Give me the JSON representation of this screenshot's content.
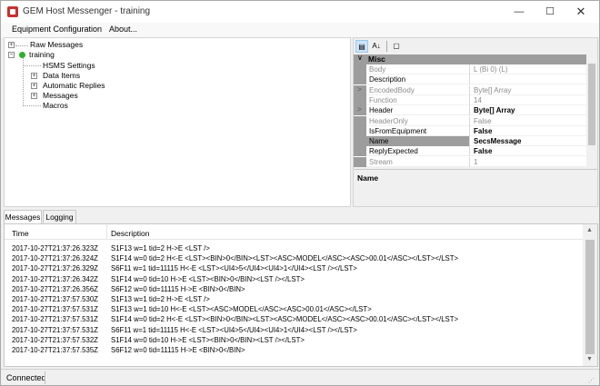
{
  "window": {
    "title": "GEM Host Messenger - training",
    "minimize_glyph": "—",
    "maximize_glyph": "☐",
    "close_glyph": "✕"
  },
  "menu": {
    "items": [
      "Equipment Configuration",
      "About..."
    ]
  },
  "tree": {
    "root_items": [
      {
        "label": "Raw Messages",
        "expander": "+"
      },
      {
        "label": "training",
        "expander": "−",
        "status_color": "#2db12d"
      }
    ],
    "children": [
      {
        "label": "HSMS Settings",
        "expander": ""
      },
      {
        "label": "Data Items",
        "expander": "+"
      },
      {
        "label": "Automatic Replies",
        "expander": "+"
      },
      {
        "label": "Messages",
        "expander": "+"
      },
      {
        "label": "Macros",
        "expander": ""
      }
    ]
  },
  "property_grid": {
    "toolbar": {
      "categorized_icon": "▤",
      "alphabetical_icon": "A↓",
      "pages_icon": "▢"
    },
    "category": {
      "label": "Misc",
      "arrow": "∨"
    },
    "rows": [
      {
        "name": "Body",
        "value": "L (Bi 0) (L)",
        "readonly": true,
        "bold": false,
        "expander": ""
      },
      {
        "name": "Description",
        "value": "",
        "readonly": false,
        "bold": false,
        "expander": ""
      },
      {
        "name": "EncodedBody",
        "value": "Byte[] Array",
        "readonly": true,
        "bold": false,
        "expander": ">"
      },
      {
        "name": "Function",
        "value": "14",
        "readonly": true,
        "bold": false,
        "expander": ""
      },
      {
        "name": "Header",
        "value": "Byte[] Array",
        "readonly": false,
        "bold": true,
        "expander": ">"
      },
      {
        "name": "HeaderOnly",
        "value": "False",
        "readonly": true,
        "bold": false,
        "expander": ""
      },
      {
        "name": "IsFromEquipment",
        "value": "False",
        "readonly": false,
        "bold": true,
        "expander": ""
      },
      {
        "name": "Name",
        "value": "SecsMessage",
        "readonly": false,
        "bold": true,
        "expander": "",
        "selected": true
      },
      {
        "name": "ReplyExpected",
        "value": "False",
        "readonly": false,
        "bold": true,
        "expander": ""
      },
      {
        "name": "Stream",
        "value": "1",
        "readonly": true,
        "bold": false,
        "expander": ""
      }
    ],
    "description_title": "Name"
  },
  "tabs": [
    "Messages",
    "Logging"
  ],
  "messages": {
    "columns": [
      "Time",
      "Description"
    ],
    "rows": [
      {
        "time": "2017-10-27T21:37:26.323Z",
        "desc": "S1F13 w=1 tid=2 H->E <LST />"
      },
      {
        "time": "2017-10-27T21:37:26.324Z",
        "desc": "S1F14 w=0 tid=2 H<-E <LST><BIN>0</BIN><LST><ASC>MODEL</ASC><ASC>00.01</ASC></LST></LST>"
      },
      {
        "time": "2017-10-27T21:37:26.329Z",
        "desc": "S6F11 w=1 tid=11115 H<-E <LST><UI4>5</UI4><UI4>1</UI4><LST /></LST>"
      },
      {
        "time": "2017-10-27T21:37:26.342Z",
        "desc": "S1F14 w=0 tid=10 H->E <LST><BIN>0</BIN><LST /></LST>"
      },
      {
        "time": "2017-10-27T21:37:26.356Z",
        "desc": "S6F12 w=0 tid=11115 H->E <BIN>0</BIN>"
      },
      {
        "time": "2017-10-27T21:37:57.530Z",
        "desc": "S1F13 w=1 tid=2 H->E <LST />"
      },
      {
        "time": "2017-10-27T21:37:57.531Z",
        "desc": "S1F13 w=1 tid=10 H<-E <LST><ASC>MODEL</ASC><ASC>00.01</ASC></LST>"
      },
      {
        "time": "2017-10-27T21:37:57.531Z",
        "desc": "S1F14 w=0 tid=2 H<-E <LST><BIN>0</BIN><LST><ASC>MODEL</ASC><ASC>00.01</ASC></LST></LST>"
      },
      {
        "time": "2017-10-27T21:37:57.531Z",
        "desc": "S6F11 w=1 tid=11115 H<-E <LST><UI4>5</UI4><UI4>1</UI4><LST /></LST>"
      },
      {
        "time": "2017-10-27T21:37:57.532Z",
        "desc": "S1F14 w=0 tid=10 H->E <LST><BIN>0</BIN><LST /></LST>"
      },
      {
        "time": "2017-10-27T21:37:57.535Z",
        "desc": "S6F12 w=0 tid=11115 H->E <BIN>0</BIN>"
      }
    ]
  },
  "status": {
    "text": "Connected"
  }
}
